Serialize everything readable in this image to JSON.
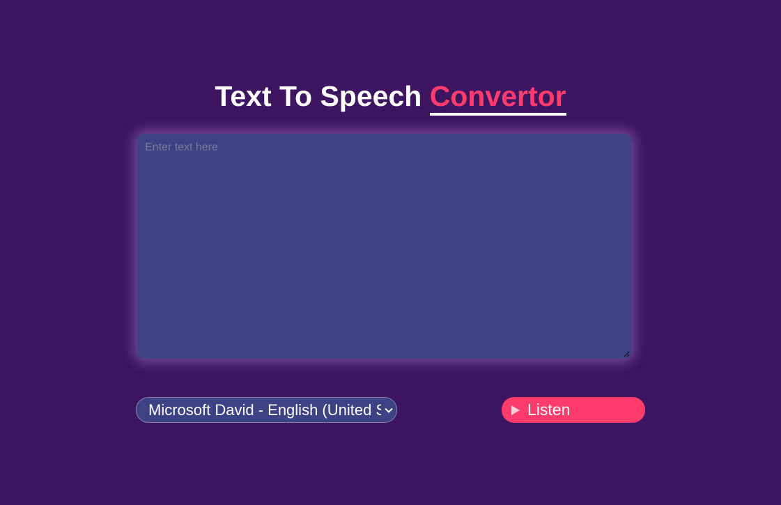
{
  "header": {
    "title_main": "Text To Speech",
    "title_accent": "Convertor"
  },
  "editor": {
    "placeholder": "Enter text here",
    "value": ""
  },
  "voice_select": {
    "selected": "Microsoft David - English (United States)"
  },
  "listen_button": {
    "label": "Listen",
    "icon": "play-icon"
  },
  "colors": {
    "background": "#3d1560",
    "panel": "#3c4283",
    "accent": "#ff3c6c",
    "text": "#ffffff"
  }
}
